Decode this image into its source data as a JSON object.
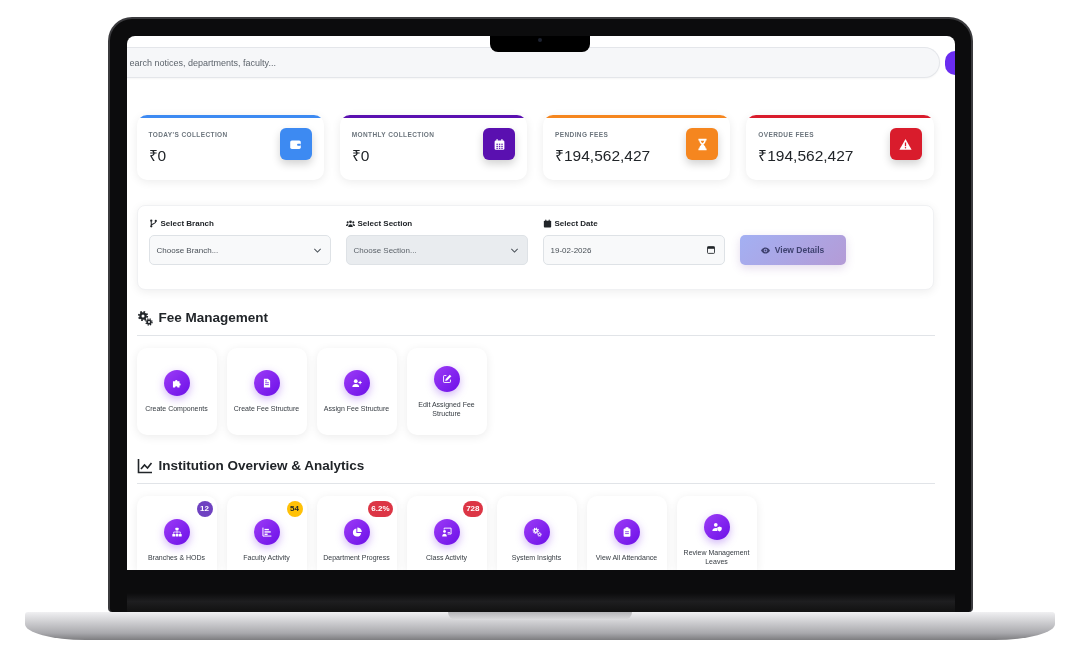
{
  "search": {
    "placeholder": "earch notices, departments, faculty..."
  },
  "stat_cards": [
    {
      "label": "TODAY'S COLLECTION",
      "value": "₹0",
      "color": "#3d8af2"
    },
    {
      "label": "MONTHLY COLLECTION",
      "value": "₹0",
      "color": "#5a10b0"
    },
    {
      "label": "PENDING FEES",
      "value": "₹194,562,427",
      "color": "#f5861f"
    },
    {
      "label": "OVERDUE FEES",
      "value": "₹194,562,427",
      "color": "#d91c2c"
    }
  ],
  "filters": {
    "fields": [
      {
        "label": "Select Branch",
        "kind": "select",
        "placeholder": "Choose Branch...",
        "disabled": false
      },
      {
        "label": "Select Section",
        "kind": "select",
        "placeholder": "Choose Section...",
        "disabled": true
      },
      {
        "label": "Select Date",
        "kind": "date",
        "value": "19-02-2026",
        "disabled": false
      }
    ],
    "button": {
      "label": "View Details",
      "disabled": true
    }
  },
  "fee_management": {
    "title": "Fee Management",
    "items": [
      {
        "label": "Create Components"
      },
      {
        "label": "Create Fee Structure"
      },
      {
        "label": "Assign Fee Structure"
      },
      {
        "label": "Edit Assigned Fee Structure"
      }
    ]
  },
  "analytics": {
    "title": "Institution Overview & Analytics",
    "items": [
      {
        "label": "Branches & HODs",
        "badge": {
          "text": "12",
          "color": "#6f42c1"
        }
      },
      {
        "label": "Faculty Activity",
        "badge": {
          "text": "54",
          "color": "#ffc107"
        }
      },
      {
        "label": "Department Progress",
        "badge": {
          "text": "6.2%",
          "color": "#dc3545"
        }
      },
      {
        "label": "Class Activity",
        "badge": {
          "text": "728",
          "color": "#dc3545"
        }
      },
      {
        "label": "System Insights"
      },
      {
        "label": "View All Attendance"
      },
      {
        "label": "Review Management Leaves"
      }
    ]
  }
}
